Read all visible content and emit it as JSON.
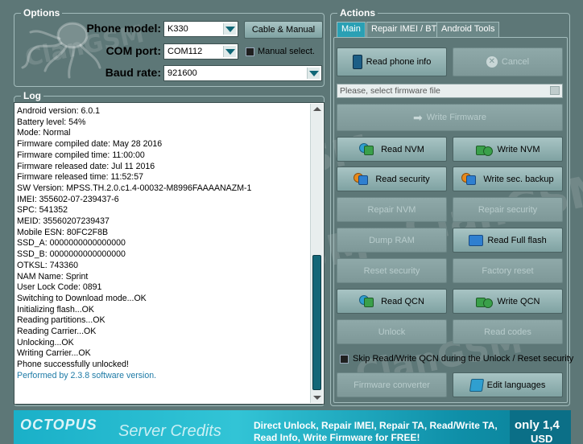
{
  "options": {
    "legend": "Options",
    "phone_model_label": "Phone model:",
    "phone_model_value": "K330",
    "com_port_label": "COM port:",
    "com_port_value": "COM112",
    "baud_rate_label": "Baud rate:",
    "baud_rate_value": "921600",
    "cable_manual_label": "Cable & Manual",
    "manual_select_label": "Manual select."
  },
  "log": {
    "legend": "Log",
    "lines": [
      "Android version: 6.0.1",
      "Battery level: 54%",
      "Mode: Normal",
      "Firmware compiled date: May 28 2016",
      "Firmware compiled time: 11:00:00",
      "Firmware released date: Jul 11 2016",
      "Firmware released time: 11:52:57",
      "SW Version: MPSS.TH.2.0.c1.4-00032-M8996FAAAANAZM-1",
      "IMEI: 355602-07-239437-6",
      "SPC: 541352",
      "MEID: 35560207239437",
      "Mobile ESN: 80FC2F8B",
      "SSD_A: 0000000000000000",
      "SSD_B: 0000000000000000",
      "OTKSL: 743360",
      "NAM Name: Sprint",
      "User Lock Code: 0891",
      "Switching to Download mode...OK",
      "Initializing flash...OK",
      "Reading partitions...OK",
      "Reading Carrier...OK",
      "Unlocking...OK",
      "Writing Carrier...OK",
      "Phone successfully unlocked!"
    ],
    "footer_line": "Performed by 2.3.8 software version."
  },
  "actions": {
    "legend": "Actions",
    "tabs": [
      "Main",
      "Repair IMEI / BT",
      "Android Tools"
    ],
    "read_phone_info": "Read phone info",
    "cancel": "Cancel",
    "firmware_placeholder": "Please, select firmware file",
    "write_firmware": "Write Firmware",
    "read_nvm": "Read NVM",
    "write_nvm": "Write NVM",
    "read_security": "Read security",
    "write_sec_backup": "Write sec. backup",
    "repair_nvm": "Repair NVM",
    "repair_security": "Repair security",
    "dump_ram": "Dump RAM",
    "read_full_flash": "Read Full flash",
    "reset_security": "Reset security",
    "factory_reset": "Factory reset",
    "read_qcn": "Read QCN",
    "write_qcn": "Write QCN",
    "unlock": "Unlock",
    "read_codes": "Read codes",
    "skip_label": "Skip Read/Write QCN during the Unlock / Reset security",
    "firmware_converter": "Firmware converter",
    "edit_languages": "Edit languages"
  },
  "banner": {
    "brand": "OCTOPUS",
    "title": "Server Credits",
    "line1": "Direct Unlock, Repair IMEI, Repair TA, Read/Write TA,",
    "line2": "Read Info, Write Firmware for FREE!",
    "price": "only 1,4",
    "currency": "USD"
  },
  "colors": {
    "background": "#5d7777",
    "accent": "#2aa0b4",
    "log_blue": "#1d7aa6"
  }
}
